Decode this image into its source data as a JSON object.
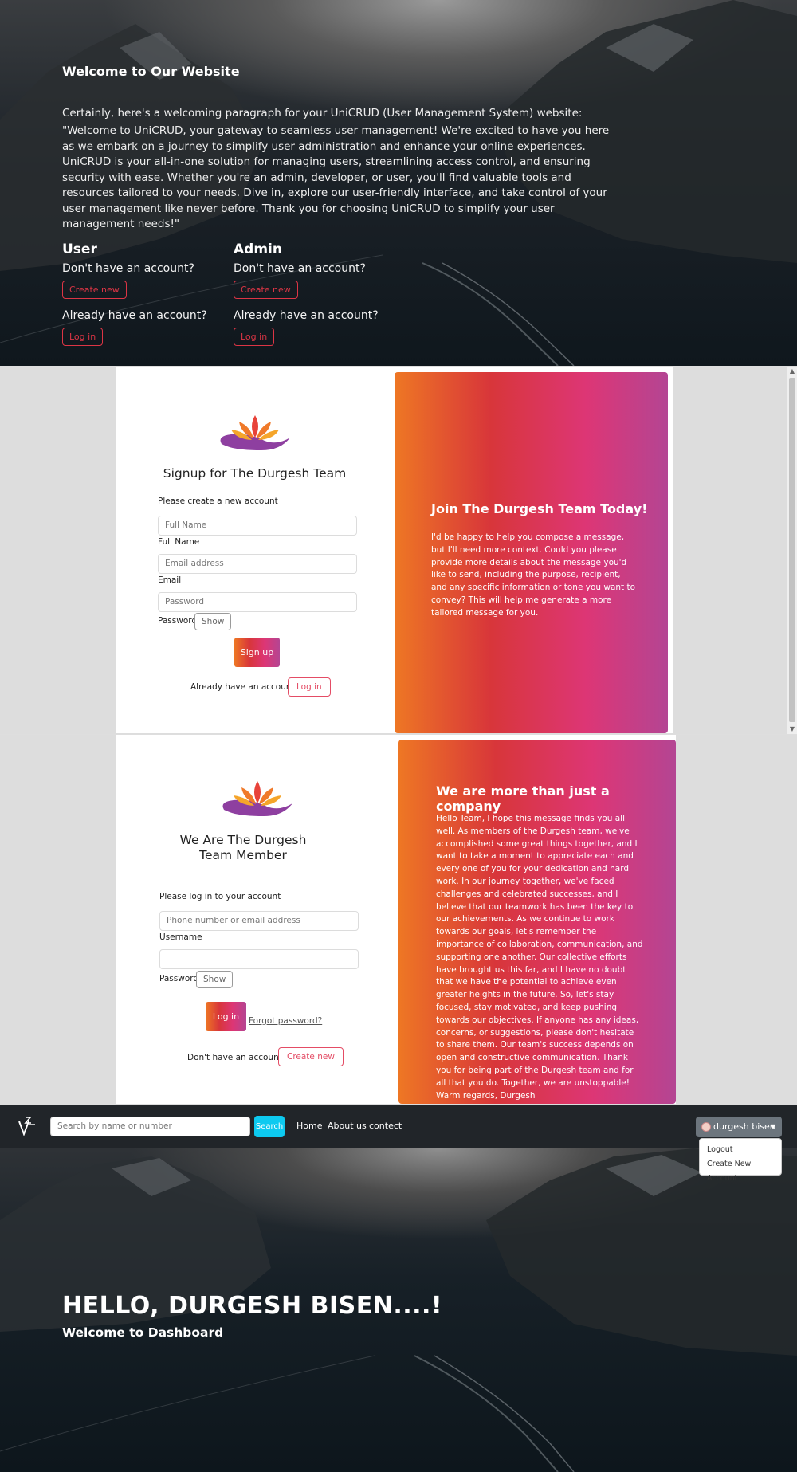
{
  "hero": {
    "title": "Welcome to Our Website",
    "lead": "Certainly, here's a welcoming paragraph for your UniCRUD (User Management System) website:",
    "quote": "\"Welcome to UniCRUD, your gateway to seamless user management! We're excited to have you here as we embark on a journey to simplify user administration and enhance your online experiences. UniCRUD is your all-in-one solution for managing users, streamlining access control, and ensuring security with ease. Whether you're an admin, developer, or user, you'll find valuable tools and resources tailored to your needs. Dive in, explore our user-friendly interface, and take control of your user management like never before. Thank you for choosing UniCRUD to simplify your user management needs!\"",
    "columns": [
      {
        "heading": "User",
        "no_account": "Don't have an account?",
        "create": "Create new",
        "have_account": "Already have an account?",
        "login": "Log in"
      },
      {
        "heading": "Admin",
        "no_account": "Don't have an account?",
        "create": "Create new",
        "have_account": "Already have an account?",
        "login": "Log in"
      }
    ]
  },
  "signup": {
    "title": "Signup for The Durgesh Team",
    "intro": "Please create a new account",
    "fullname_placeholder": "Full Name",
    "fullname_label": "Full Name",
    "email_placeholder": "Email address",
    "email_label": "Email",
    "password_placeholder": "Password",
    "password_label": "Password",
    "show_label": "Show",
    "submit_label": "Sign up",
    "have_account": "Already have an account?",
    "login_label": "Log in",
    "panel_title": "Join The Durgesh Team Today!",
    "panel_text": "I'd be happy to help you compose a message, but I'll need more context. Could you please provide more details about the message you'd like to send, including the purpose, recipient, and any specific information or tone you want to convey? This will help me generate a more tailored message for you."
  },
  "login": {
    "title": "We Are The Durgesh Team Member",
    "intro": "Please log in to your account",
    "username_placeholder": "Phone number or email address",
    "username_label": "Username",
    "password_label": "Password",
    "show_label": "Show",
    "submit_label": "Log in",
    "forgot_label": "Forgot password?",
    "no_account": "Don't have an account?",
    "create_label": "Create new",
    "panel_title": "We are more than just a company",
    "panel_text": "Hello Team, I hope this message finds you all well. As members of the Durgesh team, we've accomplished some great things together, and I want to take a moment to appreciate each and every one of you for your dedication and hard work. In our journey together, we've faced challenges and celebrated successes, and I believe that our teamwork has been the key to our achievements. As we continue to work towards our goals, let's remember the importance of collaboration, communication, and supporting one another. Our collective efforts have brought us this far, and I have no doubt that we have the potential to achieve even greater heights in the future. So, let's stay focused, stay motivated, and keep pushing towards our objectives. If anyone has any ideas, concerns, or suggestions, please don't hesitate to share them. Our team's success depends on open and constructive communication. Thank you for being part of the Durgesh team and for all that you do. Together, we are unstoppable! Warm regards, Durgesh"
  },
  "dashboard": {
    "search_placeholder": "Search by name or number",
    "search_label": "Search",
    "nav": [
      "Home",
      "About us",
      "contect"
    ],
    "user_name": "durgesh bisen",
    "dropdown": [
      "Logout",
      "Create New Account"
    ],
    "greeting": "HELLO, DURGESH BISEN....!",
    "subtitle": "Welcome to Dashboard"
  },
  "colors": {
    "danger": "#dc3545",
    "info": "#0dcaf0",
    "navbar": "#212529",
    "gradient": [
      "#ee7724",
      "#d8363a",
      "#dd3675",
      "#b44593"
    ]
  }
}
